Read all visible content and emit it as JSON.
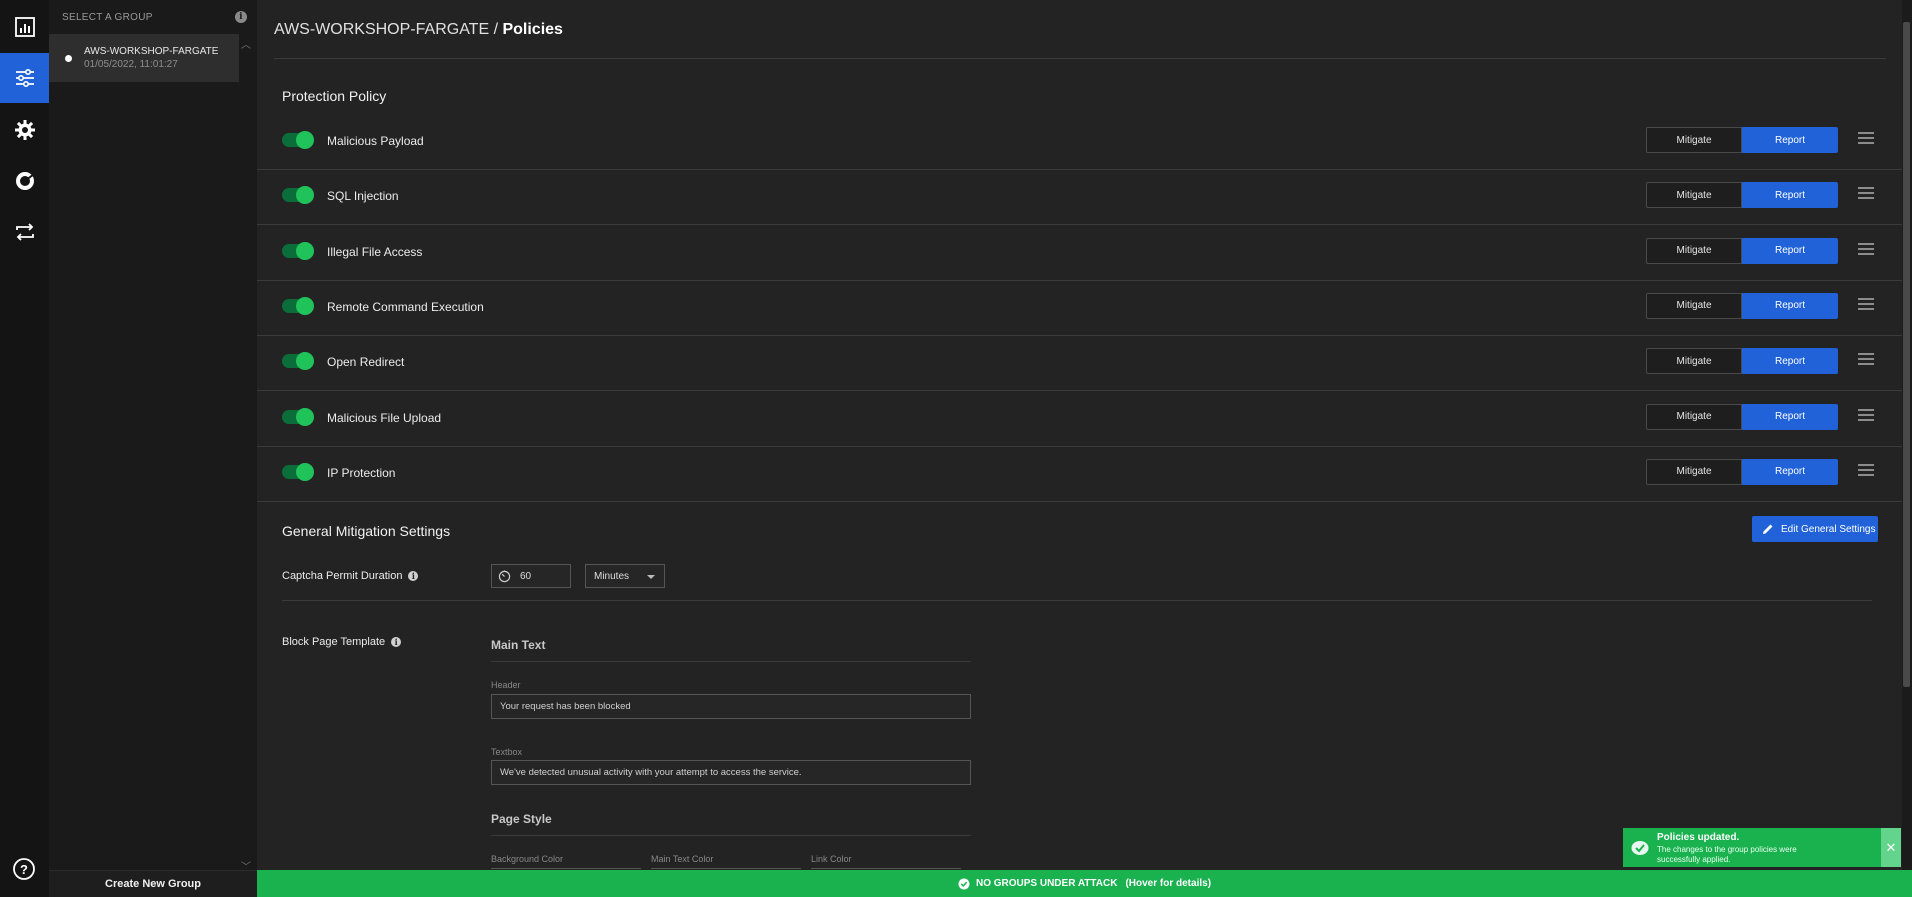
{
  "sidebar": {
    "icons": [
      "dashboard-icon",
      "policies-sliders-icon",
      "settings-gear-icon",
      "analytics-donut-icon",
      "sync-arrows-icon",
      "help-icon"
    ]
  },
  "groups": {
    "header": "SELECT A GROUP",
    "items": [
      {
        "name": "AWS-WORKSHOP-FARGATE",
        "date": "01/05/2022, 11:01:27"
      }
    ],
    "create_label": "Create New Group"
  },
  "breadcrumb": {
    "group": "AWS-WORKSHOP-FARGATE",
    "separator": " / ",
    "page": "Policies"
  },
  "protection_policy": {
    "title": "Protection Policy",
    "mitigate_label": "Mitigate",
    "report_label": "Report",
    "policies": [
      {
        "name": "Malicious Payload",
        "enabled": true,
        "mode": "Report"
      },
      {
        "name": "SQL Injection",
        "enabled": true,
        "mode": "Report"
      },
      {
        "name": "Illegal File Access",
        "enabled": true,
        "mode": "Report"
      },
      {
        "name": "Remote Command Execution",
        "enabled": true,
        "mode": "Report"
      },
      {
        "name": "Open Redirect",
        "enabled": true,
        "mode": "Report"
      },
      {
        "name": "Malicious File Upload",
        "enabled": true,
        "mode": "Report"
      },
      {
        "name": "IP Protection",
        "enabled": true,
        "mode": "Report"
      }
    ]
  },
  "mitigation": {
    "title": "General Mitigation Settings",
    "edit_label": "Edit General Settings",
    "captcha_label": "Captcha Permit Duration",
    "captcha_value": "60",
    "captcha_unit": "Minutes",
    "block_page_label": "Block Page Template",
    "main_text_title": "Main Text",
    "header_label": "Header",
    "header_value": "Your request has been blocked",
    "textbox_label": "Textbox",
    "textbox_value": "We've detected unusual activity with your attempt to access the service.",
    "page_style_title": "Page Style",
    "bg_color_label": "Background Color",
    "main_text_color_label": "Main Text Color",
    "link_color_label": "Link Color"
  },
  "toast": {
    "title": "Policies updated.",
    "message": "The changes to the group policies were successfully applied.",
    "close": "✕"
  },
  "status_bar": {
    "text": "NO GROUPS UNDER ATTACK",
    "hover": "(Hover for details)"
  },
  "colors": {
    "accent": "#2162d8",
    "success": "#19b24f",
    "toggle_on": "#1fc35a",
    "background": "#232323"
  }
}
